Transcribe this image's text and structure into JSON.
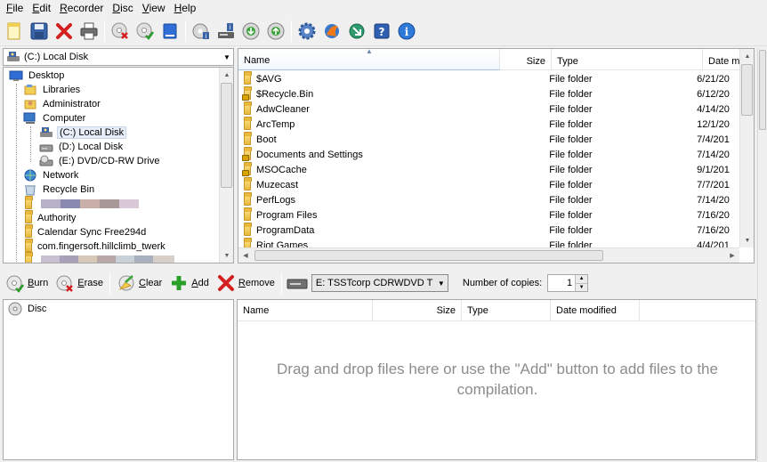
{
  "menu": [
    {
      "label": "File",
      "key": "F",
      "rest": "ile"
    },
    {
      "label": "Edit",
      "key": "E",
      "rest": "dit"
    },
    {
      "label": "Recorder",
      "key": "R",
      "rest": "ecorder"
    },
    {
      "label": "Disc",
      "key": "D",
      "rest": "isc"
    },
    {
      "label": "View",
      "key": "V",
      "rest": "iew"
    },
    {
      "label": "Help",
      "key": "H",
      "rest": "elp"
    }
  ],
  "drive_combo": {
    "value": "(C:) Local Disk"
  },
  "tree": [
    {
      "label": "Desktop",
      "icon": "desktop-icon"
    },
    {
      "label": "Libraries",
      "icon": "libraries-icon"
    },
    {
      "label": "Administrator",
      "icon": "user-folder-icon"
    },
    {
      "label": "Computer",
      "icon": "computer-icon"
    },
    {
      "label": "(C:) Local Disk",
      "icon": "hard-drive-icon"
    },
    {
      "label": "(D:) Local Disk",
      "icon": "hard-drive-icon"
    },
    {
      "label": "(E:) DVD/CD-RW Drive",
      "icon": "dvd-drive-icon"
    },
    {
      "label": "Network",
      "icon": "network-icon"
    },
    {
      "label": "Recycle Bin",
      "icon": "recycle-bin-icon"
    },
    {
      "label": "",
      "icon": "folder-icon"
    },
    {
      "label": "Authority",
      "icon": "folder-icon"
    },
    {
      "label": "Calendar Sync Free294d",
      "icon": "folder-icon"
    },
    {
      "label": "com.fingersoft.hillclimb_twerk",
      "icon": "folder-icon"
    },
    {
      "label": "",
      "icon": "folder-icon"
    }
  ],
  "filelist": {
    "columns": {
      "name": "Name",
      "size": "Size",
      "type": "Type",
      "date": "Date mo"
    },
    "rows": [
      {
        "name": "$AVG",
        "type": "File folder",
        "date": "6/21/20",
        "locked": false
      },
      {
        "name": "$Recycle.Bin",
        "type": "File folder",
        "date": "6/12/20",
        "locked": true
      },
      {
        "name": "AdwCleaner",
        "type": "File folder",
        "date": "4/14/20",
        "locked": false
      },
      {
        "name": "ArcTemp",
        "type": "File folder",
        "date": "12/1/20",
        "locked": false
      },
      {
        "name": "Boot",
        "type": "File folder",
        "date": "7/4/201",
        "locked": false
      },
      {
        "name": "Documents and Settings",
        "type": "File folder",
        "date": "7/14/20",
        "locked": true
      },
      {
        "name": "MSOCache",
        "type": "File folder",
        "date": "9/1/201",
        "locked": true
      },
      {
        "name": "Muzecast",
        "type": "File folder",
        "date": "7/7/201",
        "locked": false
      },
      {
        "name": "PerfLogs",
        "type": "File folder",
        "date": "7/14/20",
        "locked": false
      },
      {
        "name": "Program Files",
        "type": "File folder",
        "date": "7/16/20",
        "locked": false
      },
      {
        "name": "ProgramData",
        "type": "File folder",
        "date": "7/16/20",
        "locked": false
      },
      {
        "name": "Riot Games",
        "type": "File folder",
        "date": "4/4/201",
        "locked": false
      }
    ]
  },
  "compile_toolbar": {
    "burn": {
      "key": "B",
      "rest": "urn"
    },
    "erase": {
      "key": "E",
      "rest": "rase"
    },
    "clear": {
      "key": "C",
      "rest": "lear"
    },
    "add": {
      "key": "A",
      "rest": "dd"
    },
    "remove": {
      "key": "R",
      "rest": "emove"
    },
    "recorder_value": "E: TSSTcorp CDRWDVD T",
    "copies_label": "Number of copies:",
    "copies_value": "1"
  },
  "disc_tree": {
    "root_label": "Disc"
  },
  "compilation": {
    "columns": {
      "name": "Name",
      "size": "Size",
      "type": "Type",
      "date": "Date modified"
    },
    "empty_message": "Drag and drop files here or use the \"Add\" button to add files to the compilation."
  },
  "colors": {
    "folder": "#e8b93c",
    "selection": "#e8eef7",
    "drop_text": "#8c8c8c"
  }
}
